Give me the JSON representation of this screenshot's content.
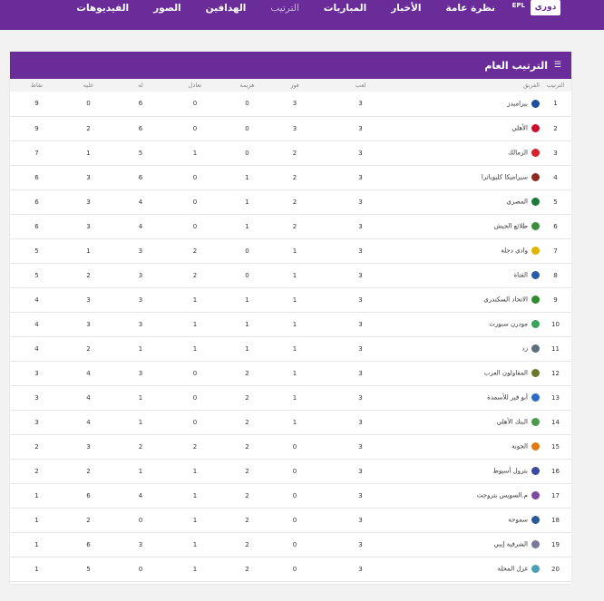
{
  "header": {
    "logo_mark": "دوري ORA",
    "logo_sub": "EPL",
    "nav": [
      "نظرة عامة",
      "الأخبار",
      "المباريات",
      "الترتيب",
      "الهدافين",
      "الصور",
      "الفيديوهات"
    ],
    "active_nav": "الترتيب"
  },
  "standings": {
    "title": "الترتيب العام",
    "columns": {
      "pos": "الترتيب",
      "team": "الفريق",
      "played": "لعب",
      "won": "فوز",
      "lost": "هزيمة",
      "drawn": "تعادل",
      "gf": "له",
      "ga": "عليه",
      "pts": "نقاط"
    },
    "rows": [
      {
        "pos": "1",
        "team": "بيراميدز",
        "color": "#1f4e9c",
        "played": "3",
        "won": "3",
        "lost": "0",
        "drawn": "0",
        "gf": "6",
        "ga": "0",
        "pts": "9"
      },
      {
        "pos": "2",
        "team": "الأهلي",
        "color": "#c8102e",
        "played": "3",
        "won": "3",
        "lost": "0",
        "drawn": "0",
        "gf": "6",
        "ga": "2",
        "pts": "9"
      },
      {
        "pos": "3",
        "team": "الزمالك",
        "color": "#d62128",
        "played": "3",
        "won": "2",
        "lost": "0",
        "drawn": "1",
        "gf": "5",
        "ga": "1",
        "pts": "7"
      },
      {
        "pos": "4",
        "team": "سيراميكا كليوباترا",
        "color": "#8b2a1e",
        "played": "3",
        "won": "2",
        "lost": "1",
        "drawn": "0",
        "gf": "6",
        "ga": "3",
        "pts": "6"
      },
      {
        "pos": "5",
        "team": "المصري",
        "color": "#1a7a3a",
        "played": "3",
        "won": "2",
        "lost": "1",
        "drawn": "0",
        "gf": "4",
        "ga": "3",
        "pts": "6"
      },
      {
        "pos": "6",
        "team": "طلائع الجيش",
        "color": "#3c8d3c",
        "played": "3",
        "won": "2",
        "lost": "1",
        "drawn": "0",
        "gf": "4",
        "ga": "3",
        "pts": "6"
      },
      {
        "pos": "7",
        "team": "وادي دجلة",
        "color": "#e2b400",
        "played": "3",
        "won": "1",
        "lost": "0",
        "drawn": "2",
        "gf": "3",
        "ga": "1",
        "pts": "5"
      },
      {
        "pos": "8",
        "team": "القناة",
        "color": "#2a5aa8",
        "played": "3",
        "won": "1",
        "lost": "0",
        "drawn": "2",
        "gf": "3",
        "ga": "2",
        "pts": "5"
      },
      {
        "pos": "9",
        "team": "الاتحاد السكندري",
        "color": "#2e8b2e",
        "played": "3",
        "won": "1",
        "lost": "1",
        "drawn": "1",
        "gf": "3",
        "ga": "3",
        "pts": "4"
      },
      {
        "pos": "10",
        "team": "مودرن سبورت",
        "color": "#3aa35a",
        "played": "3",
        "won": "1",
        "lost": "1",
        "drawn": "1",
        "gf": "3",
        "ga": "3",
        "pts": "4"
      },
      {
        "pos": "11",
        "team": "زد",
        "color": "#5a6f7a",
        "played": "3",
        "won": "1",
        "lost": "1",
        "drawn": "1",
        "gf": "1",
        "ga": "2",
        "pts": "4"
      },
      {
        "pos": "12",
        "team": "المقاولون العرب",
        "color": "#6b7a2a",
        "played": "3",
        "won": "1",
        "lost": "2",
        "drawn": "0",
        "gf": "3",
        "ga": "4",
        "pts": "3"
      },
      {
        "pos": "13",
        "team": "أبو قير للأسمدة",
        "color": "#2b6cc4",
        "played": "3",
        "won": "1",
        "lost": "2",
        "drawn": "0",
        "gf": "1",
        "ga": "4",
        "pts": "3"
      },
      {
        "pos": "14",
        "team": "البنك الأهلي",
        "color": "#4a9a4a",
        "played": "3",
        "won": "1",
        "lost": "2",
        "drawn": "0",
        "gf": "1",
        "ga": "4",
        "pts": "3"
      },
      {
        "pos": "15",
        "team": "الجونة",
        "color": "#e07a10",
        "played": "3",
        "won": "0",
        "lost": "2",
        "drawn": "2",
        "gf": "2",
        "ga": "3",
        "pts": "2"
      },
      {
        "pos": "16",
        "team": "بترول أسيوط",
        "color": "#3a4aa0",
        "played": "3",
        "won": "0",
        "lost": "2",
        "drawn": "1",
        "gf": "1",
        "ga": "2",
        "pts": "2"
      },
      {
        "pos": "17",
        "team": "م.السويس بتروجت",
        "color": "#7a4aa0",
        "played": "3",
        "won": "0",
        "lost": "2",
        "drawn": "1",
        "gf": "4",
        "ga": "6",
        "pts": "1"
      },
      {
        "pos": "18",
        "team": "سموحة",
        "color": "#2a5a9a",
        "played": "3",
        "won": "0",
        "lost": "2",
        "drawn": "1",
        "gf": "0",
        "ga": "2",
        "pts": "1"
      },
      {
        "pos": "19",
        "team": "الشرقية إيبي",
        "color": "#7a7aa0",
        "played": "3",
        "won": "0",
        "lost": "2",
        "drawn": "1",
        "gf": "3",
        "ga": "6",
        "pts": "1"
      },
      {
        "pos": "20",
        "team": "غزل المحلة",
        "color": "#4aa0b8",
        "played": "3",
        "won": "0",
        "lost": "2",
        "drawn": "1",
        "gf": "0",
        "ga": "5",
        "pts": "1"
      }
    ]
  }
}
